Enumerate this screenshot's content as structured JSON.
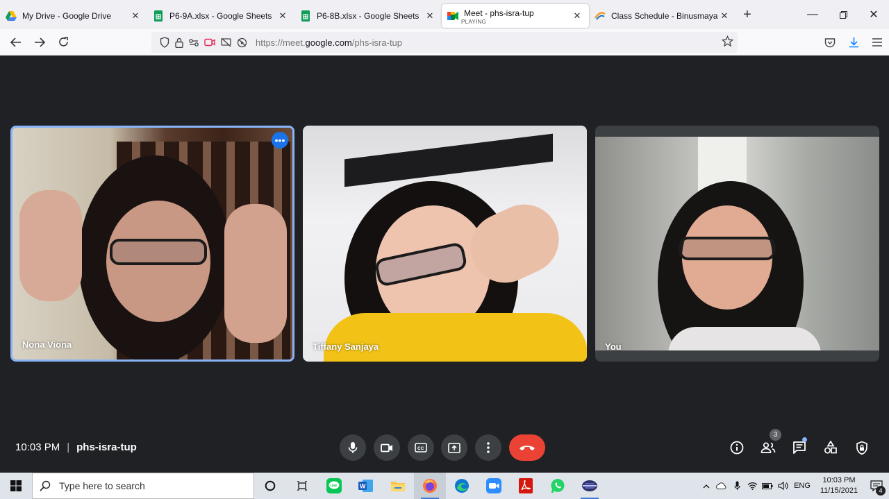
{
  "browser": {
    "tabs": [
      {
        "label": "My Drive - Google Drive",
        "icon": "google-drive-icon"
      },
      {
        "label": "P6-9A.xlsx - Google Sheets",
        "icon": "google-sheets-icon"
      },
      {
        "label": "P6-8B.xlsx - Google Sheets",
        "icon": "google-sheets-icon"
      },
      {
        "label": "Meet - phs-isra-tup",
        "sublabel": "PLAYING",
        "icon": "google-meet-icon",
        "active": true
      },
      {
        "label": "Class Schedule - Binusmaya",
        "icon": "binusmaya-icon"
      }
    ],
    "url_prefix": "https://meet.",
    "url_domain": "google.com",
    "url_path": "/phs-isra-tup"
  },
  "meeting": {
    "participants": [
      {
        "name": "Nona Viona",
        "speaking": true
      },
      {
        "name": "Tiffany Sanjaya"
      },
      {
        "name": "You"
      }
    ],
    "time": "10:03 PM",
    "separator": "|",
    "code": "phs-isra-tup",
    "people_count": "3",
    "end_color": "#ea4335",
    "accent": "#8ab4f8"
  },
  "taskbar": {
    "search_placeholder": "Type here to search",
    "apps": [
      "task-view",
      "line",
      "word",
      "file-explorer",
      "firefox",
      "edge",
      "zoom",
      "acrobat",
      "whatsapp",
      "app"
    ],
    "lang": "ENG",
    "time": "10:03 PM",
    "date": "11/15/2021",
    "notifications": "4"
  }
}
